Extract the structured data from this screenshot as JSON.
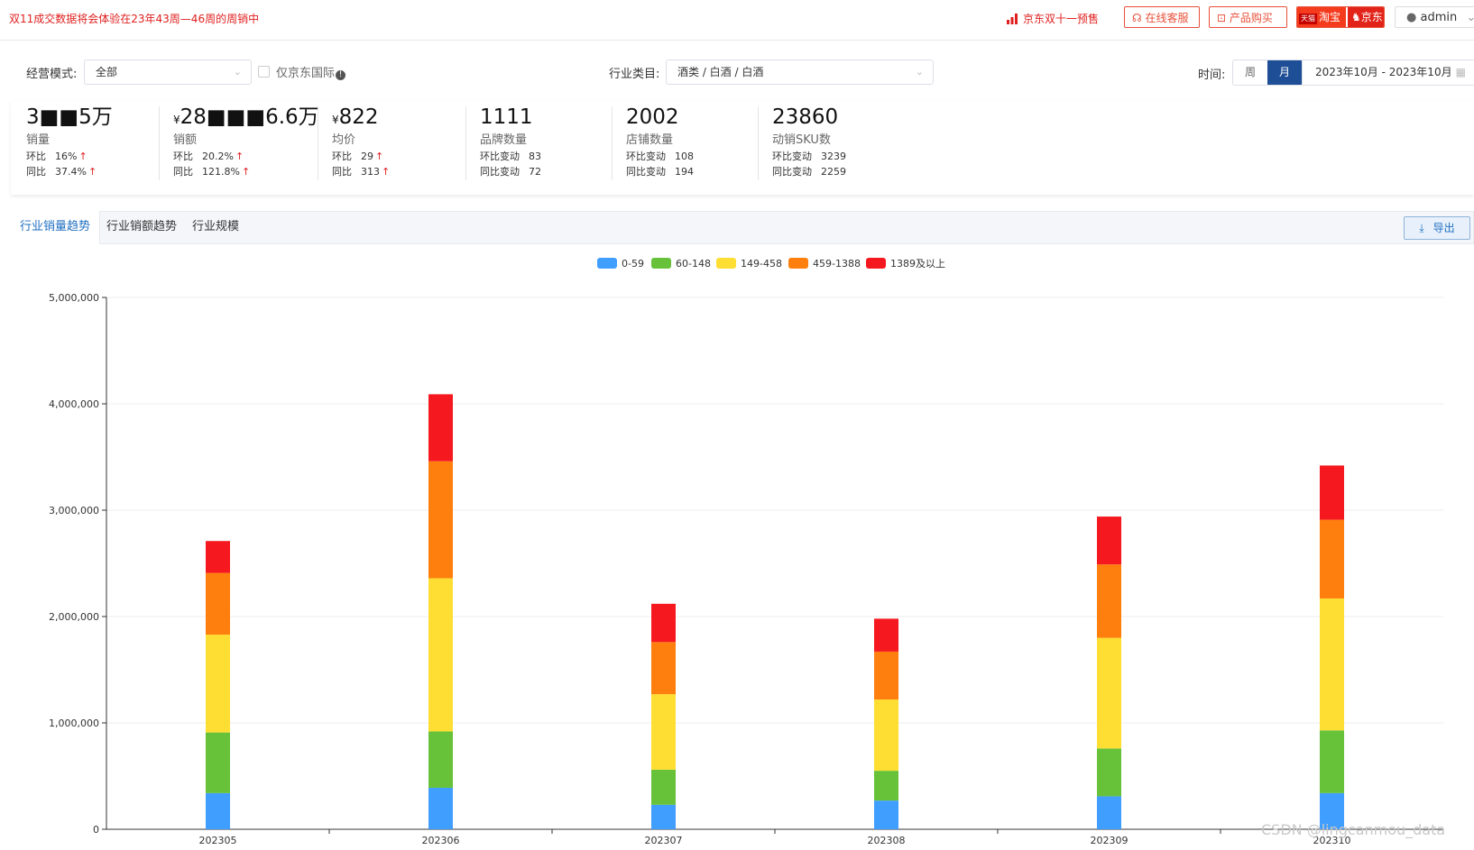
{
  "topbar": {
    "notice": "双11成交数据将会体验在23年43周—46周的周销中",
    "promo": "京东双十一预售",
    "service_btn": "在线客服",
    "buy_btn": "产品购买",
    "taobao_label": "淘宝",
    "tmall_label": "天猫",
    "jd_label": "京东",
    "user": "admin"
  },
  "filters": {
    "mode_label": "经营模式:",
    "mode_value": "全部",
    "jd_intl_label": "仅京东国际",
    "industry_label": "行业类目:",
    "industry_value": "酒类 / 白酒 / 白酒",
    "time_label": "时间:",
    "period_week": "周",
    "period_month": "月",
    "date_range": "2023年10月 - 2023年10月"
  },
  "stats": [
    {
      "value": "3■■5万",
      "currency": "",
      "name": "销量",
      "l1": "环比",
      "v1": "16%",
      "a1": "↑",
      "l2": "同比",
      "v2": "37.4%",
      "a2": "↑"
    },
    {
      "value": "28■■■6.6万",
      "currency": "¥",
      "name": "销额",
      "l1": "环比",
      "v1": "20.2%",
      "a1": "↑",
      "l2": "同比",
      "v2": "121.8%",
      "a2": "↑"
    },
    {
      "value": "822",
      "currency": "¥",
      "name": "均价",
      "l1": "环比",
      "v1": "29",
      "a1": "↑",
      "l2": "同比",
      "v2": "313",
      "a2": "↑"
    },
    {
      "value": "1111",
      "currency": "",
      "name": "品牌数量",
      "l1": "环比变动",
      "v1": "83",
      "a1": "",
      "l2": "同比变动",
      "v2": "72",
      "a2": ""
    },
    {
      "value": "2002",
      "currency": "",
      "name": "店铺数量",
      "l1": "环比变动",
      "v1": "108",
      "a1": "",
      "l2": "同比变动",
      "v2": "194",
      "a2": ""
    },
    {
      "value": "23860",
      "currency": "",
      "name": "动销SKU数",
      "l1": "环比变动",
      "v1": "3239",
      "a1": "",
      "l2": "同比变动",
      "v2": "2259",
      "a2": ""
    }
  ],
  "tabs": {
    "items": [
      "行业销量趋势",
      "行业销额趋势",
      "行业规模"
    ],
    "active": 0,
    "export_label": "导出"
  },
  "colors": {
    "accent": "#1f6fc1",
    "alert": "#e02020",
    "series": [
      "#409eff",
      "#67c23a",
      "#ffde33",
      "#ff7f0e",
      "#f5191f"
    ]
  },
  "chart_data": {
    "type": "bar",
    "stacked": true,
    "categories": [
      "202305",
      "202306",
      "202307",
      "202308",
      "202309",
      "202310"
    ],
    "series": [
      {
        "name": "0-59",
        "values": [
          340000,
          390000,
          230000,
          270000,
          310000,
          340000
        ]
      },
      {
        "name": "60-148",
        "values": [
          570000,
          530000,
          330000,
          280000,
          450000,
          590000
        ]
      },
      {
        "name": "149-458",
        "values": [
          920000,
          1440000,
          710000,
          670000,
          1040000,
          1240000
        ]
      },
      {
        "name": "459-1388",
        "values": [
          580000,
          1100000,
          490000,
          450000,
          690000,
          740000
        ]
      },
      {
        "name": "1389及以上",
        "values": [
          300000,
          630000,
          360000,
          310000,
          450000,
          510000
        ]
      }
    ],
    "ylim": [
      0,
      5000000
    ],
    "yticks": [
      "0",
      "1,000,000",
      "2,000,000",
      "3,000,000",
      "4,000,000",
      "5,000,000"
    ],
    "grid": true,
    "legend": "top-center"
  },
  "watermark": "CSDN @lingcanmou_data"
}
